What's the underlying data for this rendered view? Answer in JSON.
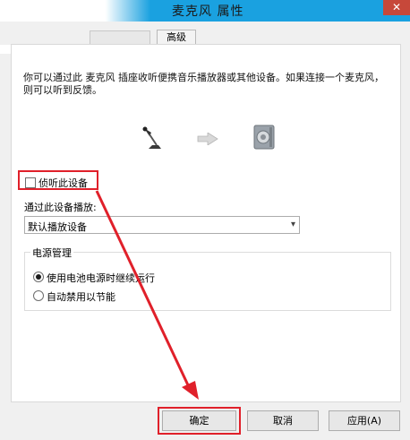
{
  "window": {
    "title": "麦克风 属性",
    "close_glyph": "✕"
  },
  "tabs": [
    {
      "label": "高级"
    }
  ],
  "listen": {
    "description": "你可以通过此 麦克风 插座收听便携音乐播放器或其他设备。如果连接一个麦克风，则可以听到反馈。",
    "checkbox_label": "侦听此设备",
    "checkbox_checked": false,
    "playback_label": "通过此设备播放:",
    "playback_device": "默认播放设备",
    "icons": [
      "microphone-icon",
      "right-arrow-icon",
      "speaker-icon"
    ]
  },
  "power": {
    "title": "电源管理",
    "options": [
      {
        "label": "使用电池电源时继续运行",
        "selected": true
      },
      {
        "label": "自动禁用以节能",
        "selected": false
      }
    ]
  },
  "buttons": {
    "ok": "确定",
    "cancel": "取消",
    "apply": "应用(A)"
  },
  "annotation": {
    "color": "#e0202a"
  }
}
